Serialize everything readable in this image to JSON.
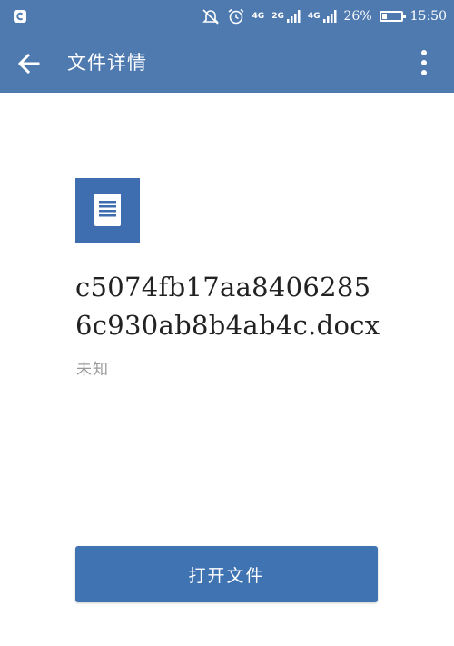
{
  "status_bar": {
    "battery_percent": "26%",
    "battery_level": 0.26,
    "time": "15:50",
    "net1_label": "2G",
    "net2_label": "4G",
    "volte_label": "4G",
    "icons": [
      "app-shield-icon",
      "mute-notification-icon",
      "alarm-icon",
      "volte-icon",
      "signal-icon",
      "signal-icon",
      "battery-icon"
    ]
  },
  "app_bar": {
    "title": "文件详情",
    "back_icon": "arrow-left-icon",
    "menu_icon": "more-vertical-icon"
  },
  "file": {
    "icon": "document-icon",
    "name": "c5074fb17aa84062856c930ab8b4ab4c.docx",
    "size": "未知"
  },
  "actions": {
    "open_label": "打开文件"
  },
  "colors": {
    "bar": "#4f7ab0",
    "accent": "#4073b2",
    "icon_bg": "#3e6db0",
    "secondary_text": "#9a9a9a"
  }
}
